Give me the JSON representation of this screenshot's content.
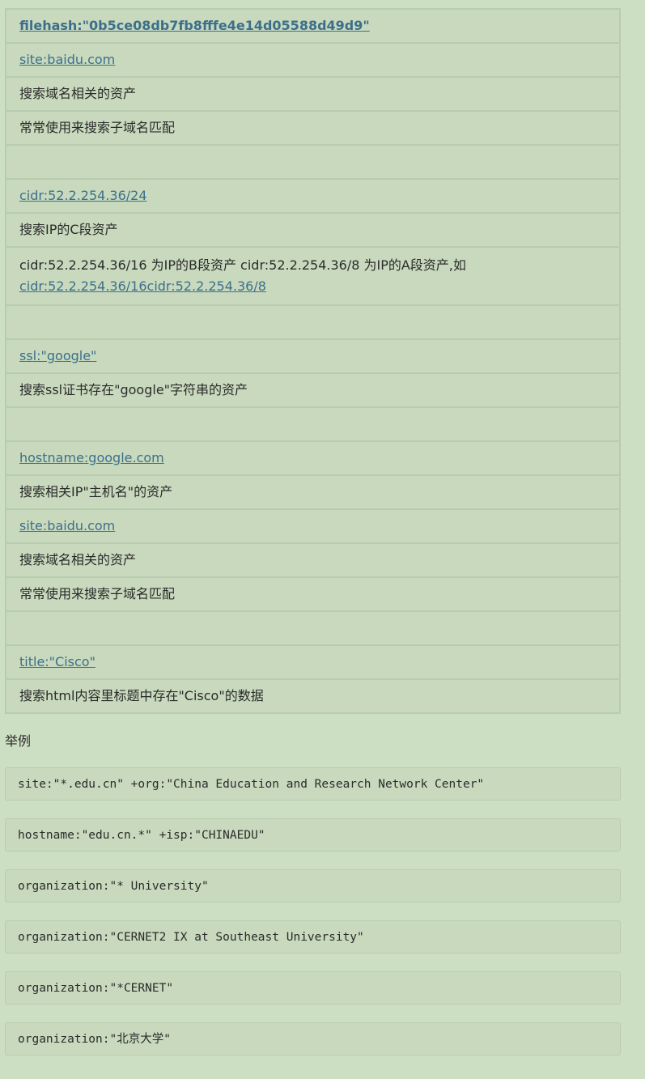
{
  "table_rows": [
    {
      "type": "link",
      "text": "filehash:\"0b5ce08db7fb8fffe4e14d05588d49d9\"",
      "bold": true
    },
    {
      "type": "link",
      "text": "site:baidu.com"
    },
    {
      "type": "text",
      "text": "搜索域名相关的资产"
    },
    {
      "type": "text",
      "text": "常常使用来搜索子域名匹配"
    },
    {
      "type": "empty",
      "text": ""
    },
    {
      "type": "link",
      "text": "cidr:52.2.254.36/24"
    },
    {
      "type": "text",
      "text": "搜索IP的C段资产"
    },
    {
      "type": "mixed",
      "text": "cidr:52.2.254.36/16 为IP的B段资产 cidr:52.2.254.36/8 为IP的A段资产,如",
      "link": "cidr:52.2.254.36/16cidr:52.2.254.36/8"
    },
    {
      "type": "empty",
      "text": ""
    },
    {
      "type": "link",
      "text": "ssl:\"google\""
    },
    {
      "type": "text",
      "text": "搜索ssl证书存在\"google\"字符串的资产"
    },
    {
      "type": "empty",
      "text": ""
    },
    {
      "type": "link",
      "text": "hostname:google.com"
    },
    {
      "type": "text",
      "text": "搜索相关IP\"主机名\"的资产"
    },
    {
      "type": "link",
      "text": "site:baidu.com"
    },
    {
      "type": "text",
      "text": "搜索域名相关的资产"
    },
    {
      "type": "text",
      "text": "常常使用来搜索子域名匹配"
    },
    {
      "type": "empty",
      "text": ""
    },
    {
      "type": "link",
      "text": "title:\"Cisco\""
    },
    {
      "type": "text",
      "text": "搜索html内容里标题中存在\"Cisco\"的数据"
    }
  ],
  "examples_label": "举例",
  "examples": [
    "site:\"*.edu.cn\" +org:\"China Education and Research Network Center\"",
    "hostname:\"edu.cn.*\" +isp:\"CHINAEDU\"",
    "organization:\"* University\"",
    "organization:\"CERNET2 IX at Southeast University\"",
    "organization:\"*CERNET\"",
    "organization:\"北京大学\""
  ]
}
